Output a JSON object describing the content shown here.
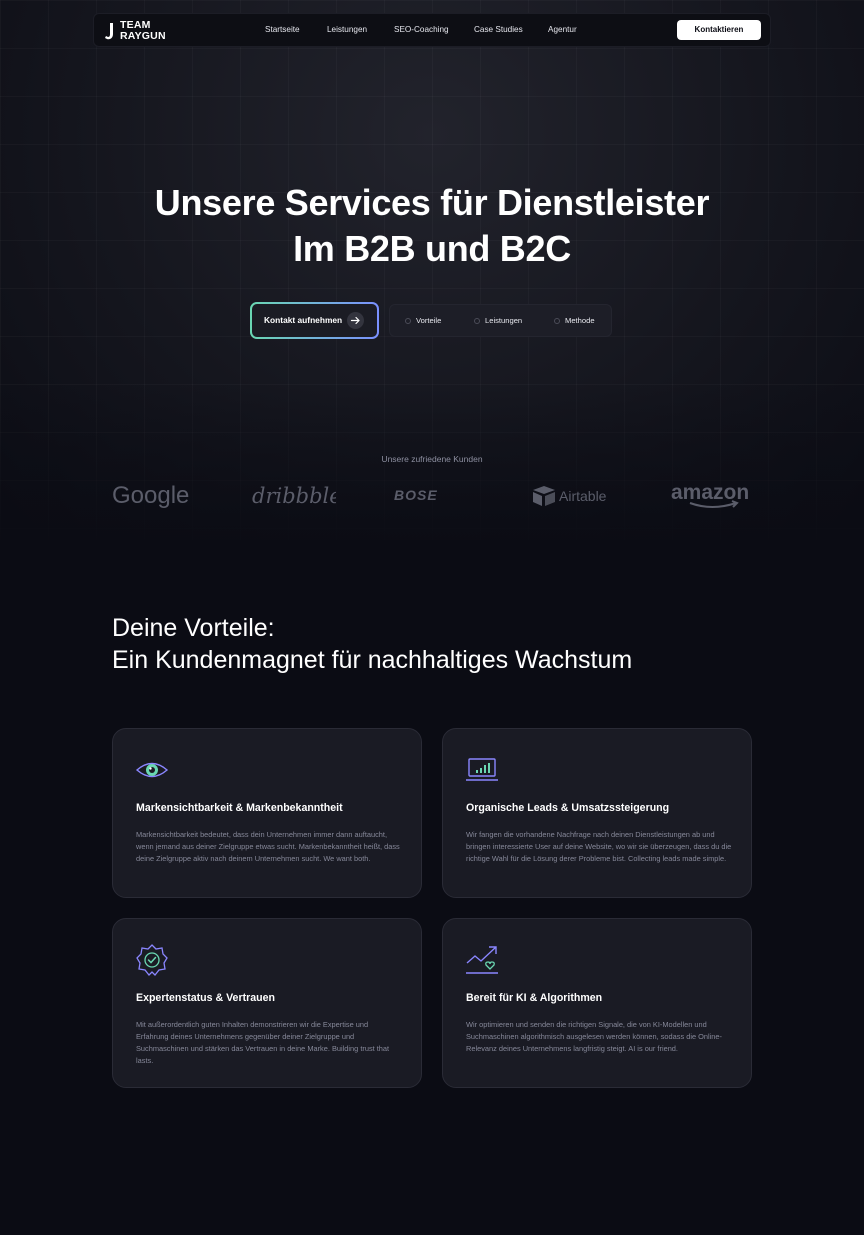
{
  "brand": {
    "logo_line1": "TEAM",
    "logo_line2": "RAYGUN"
  },
  "nav": {
    "links": [
      "Startseite",
      "Leistungen",
      "SEO-Coaching",
      "Case Studies",
      "Agentur"
    ],
    "cta_label": "Kontaktieren"
  },
  "hero": {
    "title_line1": "Unsere Services für Dienstleister",
    "title_line2": "Im B2B und B2C",
    "cta_label": "Kontakt aufnehmen",
    "pills": [
      "Vorteile",
      "Leistungen",
      "Methode"
    ]
  },
  "clients": {
    "label": "Unsere zufriedene Kunden",
    "logos": [
      "Google",
      "dribbble",
      "BOSE",
      "Airtable",
      "amazon"
    ]
  },
  "advantages": {
    "title_line1": "Deine Vorteile:",
    "title_line2": "Ein Kundenmagnet für nachhaltiges Wachstum",
    "cards": [
      {
        "icon": "eye-icon",
        "title": "Markensichtbarkeit & Markenbekanntheit",
        "text": "Markensichtbarkeit bedeutet, dass dein Unternehmen immer dann auftaucht, wenn jemand aus deiner Zielgruppe etwas sucht. Markenbekanntheit heißt, dass deine Zielgruppe aktiv nach deinem Unternehmen sucht. We want both."
      },
      {
        "icon": "laptop-chart-icon",
        "title": "Organische Leads & Umsatzssteigerung",
        "text": "Wir fangen die vorhandene Nachfrage nach deinen Dienstleistungen ab und bringen interessierte User auf deine Website, wo wir sie überzeugen, dass du die richtige Wahl für die Lösung derer Probleme bist. Collecting leads made simple."
      },
      {
        "icon": "badge-check-icon",
        "title": "Expertenstatus & Vertrauen",
        "text": "Mit außerordentlich guten Inhalten demonstrieren wir die Expertise und Erfahrung deines Unternehmens gegenüber deiner Zielgruppe und Suchmaschinen und stärken das Vertrauen in deine Marke. Building trust that lasts."
      },
      {
        "icon": "trend-heart-icon",
        "title": "Bereit für KI & Algorithmen",
        "text": "Wir optimieren und senden die richtigen Signale, die von KI-Modellen und Suchmaschinen algorithmisch ausgelesen werden können, sodass die Online-Relevanz deines Unternehmens langfristig steigt. AI is our friend."
      }
    ]
  },
  "colors": {
    "background": "#0b0c14",
    "card": "#1a1b24",
    "accent_green": "#6ad7b2",
    "accent_purple": "#7a7ff0"
  }
}
